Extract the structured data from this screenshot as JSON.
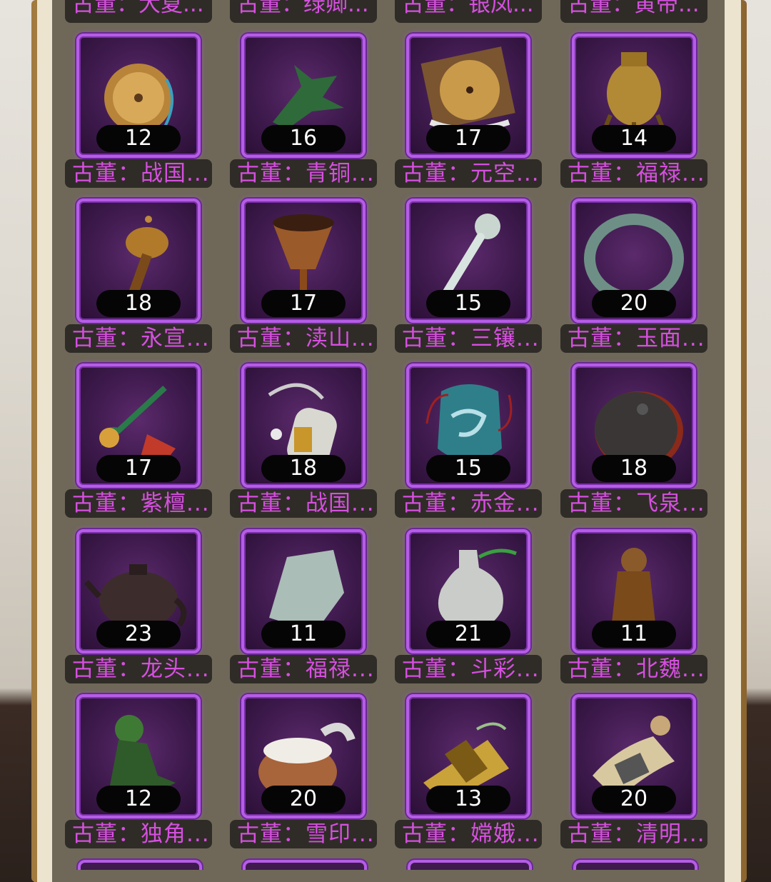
{
  "top_row_names": [
    "古董：大夏...",
    "古董：绿卿...",
    "古董：银凤...",
    "古董：黄帝..."
  ],
  "items": [
    {
      "icon": "bronze-mirror-icon",
      "count": "12",
      "name": "古董：战国...",
      "color": "#b8843a"
    },
    {
      "icon": "bronze-dragon-icon",
      "count": "16",
      "name": "古董：青铜...",
      "color": "#2f6a3a"
    },
    {
      "icon": "bronze-plate-icon",
      "count": "17",
      "name": "古董：元空...",
      "color": "#c99a4a"
    },
    {
      "icon": "gold-censer-icon",
      "count": "14",
      "name": "古董：福禄...",
      "color": "#b28a35"
    },
    {
      "icon": "gold-rattle-icon",
      "count": "18",
      "name": "古董：永宣...",
      "color": "#b07a2a"
    },
    {
      "icon": "bronze-goblet-icon",
      "count": "17",
      "name": "古董：渎山...",
      "color": "#9a5a2a"
    },
    {
      "icon": "jade-ruyi-icon",
      "count": "15",
      "name": "古董：三镶...",
      "color": "#c9d6d0"
    },
    {
      "icon": "jade-bracelet-icon",
      "count": "20",
      "name": "古董：玉面...",
      "color": "#6e8f86"
    },
    {
      "icon": "pipe-icon",
      "count": "17",
      "name": "古董：紫檀...",
      "color": "#c23a2a"
    },
    {
      "icon": "jade-pendant-icon",
      "count": "18",
      "name": "古董：战国...",
      "color": "#d8d8d0"
    },
    {
      "icon": "blue-vase-icon",
      "count": "15",
      "name": "古董：赤金...",
      "color": "#2f7f8a"
    },
    {
      "icon": "inkstone-icon",
      "count": "18",
      "name": "古董：飞泉...",
      "color": "#3a3636"
    },
    {
      "icon": "teapot-icon",
      "count": "23",
      "name": "古董：龙头...",
      "color": "#3d2c2c"
    },
    {
      "icon": "jade-stone-icon",
      "count": "11",
      "name": "古董：福禄...",
      "color": "#aabdb7"
    },
    {
      "icon": "white-vase-icon",
      "count": "21",
      "name": "古董：斗彩...",
      "color": "#c9ccc8"
    },
    {
      "icon": "wood-figure-icon",
      "count": "11",
      "name": "古董：北魏...",
      "color": "#8a5a2a"
    },
    {
      "icon": "green-beast-icon",
      "count": "12",
      "name": "古董：独角...",
      "color": "#3f7a35"
    },
    {
      "icon": "rice-pot-icon",
      "count": "20",
      "name": "古董：雪印...",
      "color": "#a8643a"
    },
    {
      "icon": "gold-frame-icon",
      "count": "13",
      "name": "古董：嫦娥...",
      "color": "#c9a23a"
    },
    {
      "icon": "scroll-icon",
      "count": "20",
      "name": "古董：清明...",
      "color": "#d8c8a0"
    }
  ]
}
